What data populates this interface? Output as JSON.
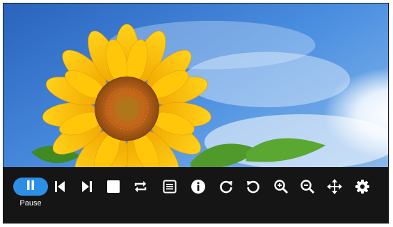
{
  "player": {
    "background_image": "sunflower-sky-photo",
    "accent_color": "#2d8ee6",
    "bar_color": "#151515",
    "icon_color": "#ffffff"
  },
  "controls": {
    "pause": {
      "label": "Pause",
      "icon": "pause-icon",
      "state": "active"
    },
    "buttons": [
      {
        "icon": "previous-icon"
      },
      {
        "icon": "next-icon"
      },
      {
        "icon": "stop-icon"
      },
      {
        "icon": "repeat-icon"
      },
      {
        "icon": "playlist-icon"
      },
      {
        "icon": "info-icon"
      },
      {
        "icon": "rotate-clockwise-icon"
      },
      {
        "icon": "rotate-counterclockwise-icon"
      },
      {
        "icon": "zoom-in-icon"
      },
      {
        "icon": "zoom-out-icon"
      },
      {
        "icon": "move-icon"
      },
      {
        "icon": "settings-icon"
      }
    ]
  }
}
